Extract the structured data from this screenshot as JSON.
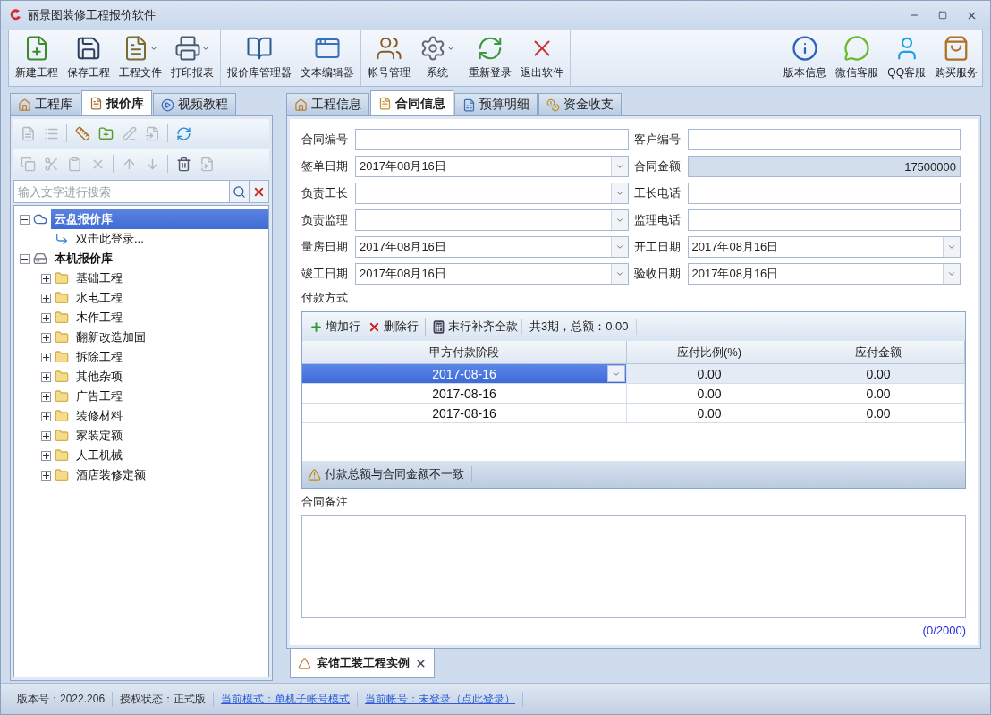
{
  "window": {
    "title": "丽景图装修工程报价软件"
  },
  "toolbar": {
    "groups": [
      [
        {
          "label": "新建工程",
          "dropdown": false
        },
        {
          "label": "保存工程",
          "dropdown": false
        },
        {
          "label": "工程文件",
          "dropdown": true
        },
        {
          "label": "打印报表",
          "dropdown": true
        }
      ],
      [
        {
          "label": "报价库管理器",
          "dropdown": false
        },
        {
          "label": "文本编辑器",
          "dropdown": false
        }
      ],
      [
        {
          "label": "帐号管理",
          "dropdown": false
        },
        {
          "label": "系统",
          "dropdown": true
        }
      ],
      [
        {
          "label": "重新登录",
          "dropdown": false
        },
        {
          "label": "退出软件",
          "dropdown": false
        }
      ]
    ],
    "right": [
      {
        "label": "版本信息"
      },
      {
        "label": "微信客服"
      },
      {
        "label": "QQ客服"
      },
      {
        "label": "购买服务"
      }
    ]
  },
  "left_panel": {
    "tabs": [
      {
        "label": "工程库",
        "selected": false
      },
      {
        "label": "报价库",
        "selected": true
      },
      {
        "label": "视频教程",
        "selected": false
      }
    ],
    "tools": [
      [
        {
          "disabled": true
        },
        {
          "disabled": true
        },
        {
          "disabled": false
        },
        {
          "disabled": false
        },
        {
          "disabled": true
        },
        {
          "disabled": true
        },
        {
          "disabled": false
        }
      ],
      [
        {
          "disabled": true
        },
        {
          "disabled": true
        },
        {
          "disabled": true
        },
        {
          "disabled": true
        },
        {
          "disabled": true
        },
        {
          "disabled": true
        },
        {
          "disabled": false
        },
        {
          "disabled": true
        }
      ]
    ],
    "search": {
      "placeholder": "输入文字进行搜索"
    },
    "tree": [
      {
        "label": "云盘报价库",
        "kind": "cloud",
        "selected": true,
        "expanded": true,
        "children": [
          {
            "label": "双击此登录...",
            "kind": "link",
            "selected": false
          }
        ]
      },
      {
        "label": "本机报价库",
        "kind": "local",
        "selected": false,
        "expanded": true,
        "children": [
          {
            "label": "基础工程",
            "kind": "folder",
            "selected": false,
            "expanded": false
          },
          {
            "label": "水电工程",
            "kind": "folder",
            "selected": false,
            "expanded": false
          },
          {
            "label": "木作工程",
            "kind": "folder",
            "selected": false,
            "expanded": false
          },
          {
            "label": "翻新改造加固",
            "kind": "folder",
            "selected": false,
            "expanded": false
          },
          {
            "label": "拆除工程",
            "kind": "folder",
            "selected": false,
            "expanded": false
          },
          {
            "label": "其他杂项",
            "kind": "folder",
            "selected": false,
            "expanded": false
          },
          {
            "label": "广告工程",
            "kind": "folder",
            "selected": false,
            "expanded": false
          },
          {
            "label": "装修材料",
            "kind": "folder",
            "selected": false,
            "expanded": false
          },
          {
            "label": "家装定额",
            "kind": "folder",
            "selected": false,
            "expanded": false
          },
          {
            "label": "人工机械",
            "kind": "folder",
            "selected": false,
            "expanded": false
          },
          {
            "label": "酒店装修定额",
            "kind": "folder",
            "selected": false,
            "expanded": false
          }
        ]
      }
    ]
  },
  "main": {
    "tabs": [
      {
        "label": "工程信息",
        "selected": false
      },
      {
        "label": "合同信息",
        "selected": true
      },
      {
        "label": "预算明细",
        "selected": false
      },
      {
        "label": "资金收支",
        "selected": false
      }
    ],
    "fields": [
      {
        "label": "合同编号",
        "kind": "text"
      },
      {
        "label": "客户编号",
        "kind": "text"
      },
      {
        "label": "签单日期",
        "value": "2017年08月16日",
        "kind": "combo"
      },
      {
        "label": "合同金额",
        "value": "17500000",
        "kind": "readonly"
      },
      {
        "label": "负责工长",
        "kind": "combo"
      },
      {
        "label": "工长电话",
        "kind": "text"
      },
      {
        "label": "负责监理",
        "kind": "combo"
      },
      {
        "label": "监理电话",
        "kind": "text"
      },
      {
        "label": "量房日期",
        "value": "2017年08月16日",
        "kind": "combo"
      },
      {
        "label": "开工日期",
        "value": "2017年08月16日",
        "kind": "combo"
      },
      {
        "label": "竣工日期",
        "value": "2017年08月16日",
        "kind": "combo"
      },
      {
        "label": "验收日期",
        "value": "2017年08月16日",
        "kind": "combo"
      }
    ],
    "payment": {
      "title": "付款方式",
      "actions": [
        {
          "label": "增加行"
        },
        {
          "label": "删除行"
        },
        {
          "label": "末行补齐全款"
        }
      ],
      "summary": "共3期，总额：0.00",
      "columns": [
        "甲方付款阶段",
        "应付比例(%)",
        "应付金额"
      ],
      "rows": [
        {
          "selected": true,
          "cells": [
            "2017-08-16",
            "0.00",
            "0.00"
          ]
        },
        {
          "selected": false,
          "cells": [
            "2017-08-16",
            "0.00",
            "0.00"
          ]
        },
        {
          "selected": false,
          "cells": [
            "2017-08-16",
            "0.00",
            "0.00"
          ]
        }
      ],
      "warning": "付款总额与合同金额不一致"
    },
    "notes": {
      "label": "合同备注",
      "counter": "(0/2000)"
    },
    "doc_tabs": [
      {
        "label": "宾馆工装工程实例",
        "selected": true
      }
    ]
  },
  "status_bar": [
    {
      "text": "版本号：2022.206",
      "kind": "text"
    },
    {
      "text": "授权状态：正式版",
      "kind": "text"
    },
    {
      "text": "当前模式：单机子帐号模式",
      "kind": "link"
    },
    {
      "text": "当前帐号：未登录（点此登录）",
      "kind": "link"
    }
  ]
}
